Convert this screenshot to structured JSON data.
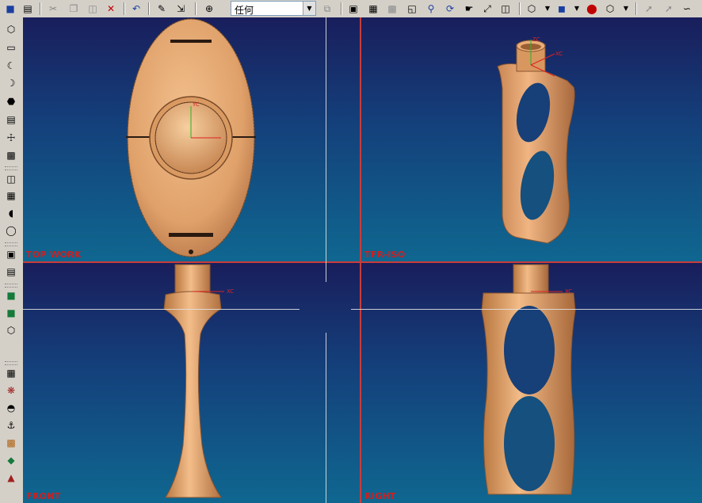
{
  "toolbar": {
    "selection_filter": {
      "value": "任何"
    },
    "icons": [
      "save-icon",
      "print-icon",
      "cut-icon",
      "copy-icon",
      "paste-icon",
      "delete-icon",
      "undo-icon",
      "edit-object-icon",
      "transform-icon",
      "snap-point-icon",
      "filter-dropdown",
      "select-all-icon",
      "fit-view-icon",
      "zoom-window-icon",
      "zoom-icon",
      "rotate-view-icon",
      "pan-icon",
      "orient-view-icon",
      "wcs-icon",
      "shaded-icon",
      "render-style-icon",
      "material-icon",
      "layer-icon",
      "line-icon",
      "curve-icon",
      "spline-icon"
    ]
  },
  "left_toolbar": {
    "icons": [
      "block-icon",
      "cylinder-icon",
      "cone-icon",
      "sphere-icon",
      "extrude-icon",
      "revolve-icon",
      "hole-icon",
      "boss-icon",
      "pocket-icon",
      "pad-icon",
      "slot-icon",
      "groove-icon",
      "blend-icon",
      "chamfer-icon",
      "shell-icon",
      "draft-icon",
      "thicken-icon",
      "unite-icon",
      "subtract-icon",
      "intersect-icon",
      "trim-body-icon",
      "split-body-icon",
      "sew-icon",
      "offset-face-icon",
      "pattern-icon"
    ]
  },
  "viewports": {
    "top_left": {
      "label": "TOP WORK"
    },
    "top_right": {
      "label": "TFR-ISO"
    },
    "bottom_left": {
      "label": "FRONT"
    },
    "bottom_right": {
      "label": "RIGHT"
    }
  },
  "axis_labels": {
    "xc": "XC",
    "yc": "YC",
    "zc": "ZC"
  },
  "colors": {
    "viewport_top": "#191e5c",
    "viewport_bottom": "#0f6790",
    "model": "#e4a774",
    "label": "#d21e1e"
  }
}
